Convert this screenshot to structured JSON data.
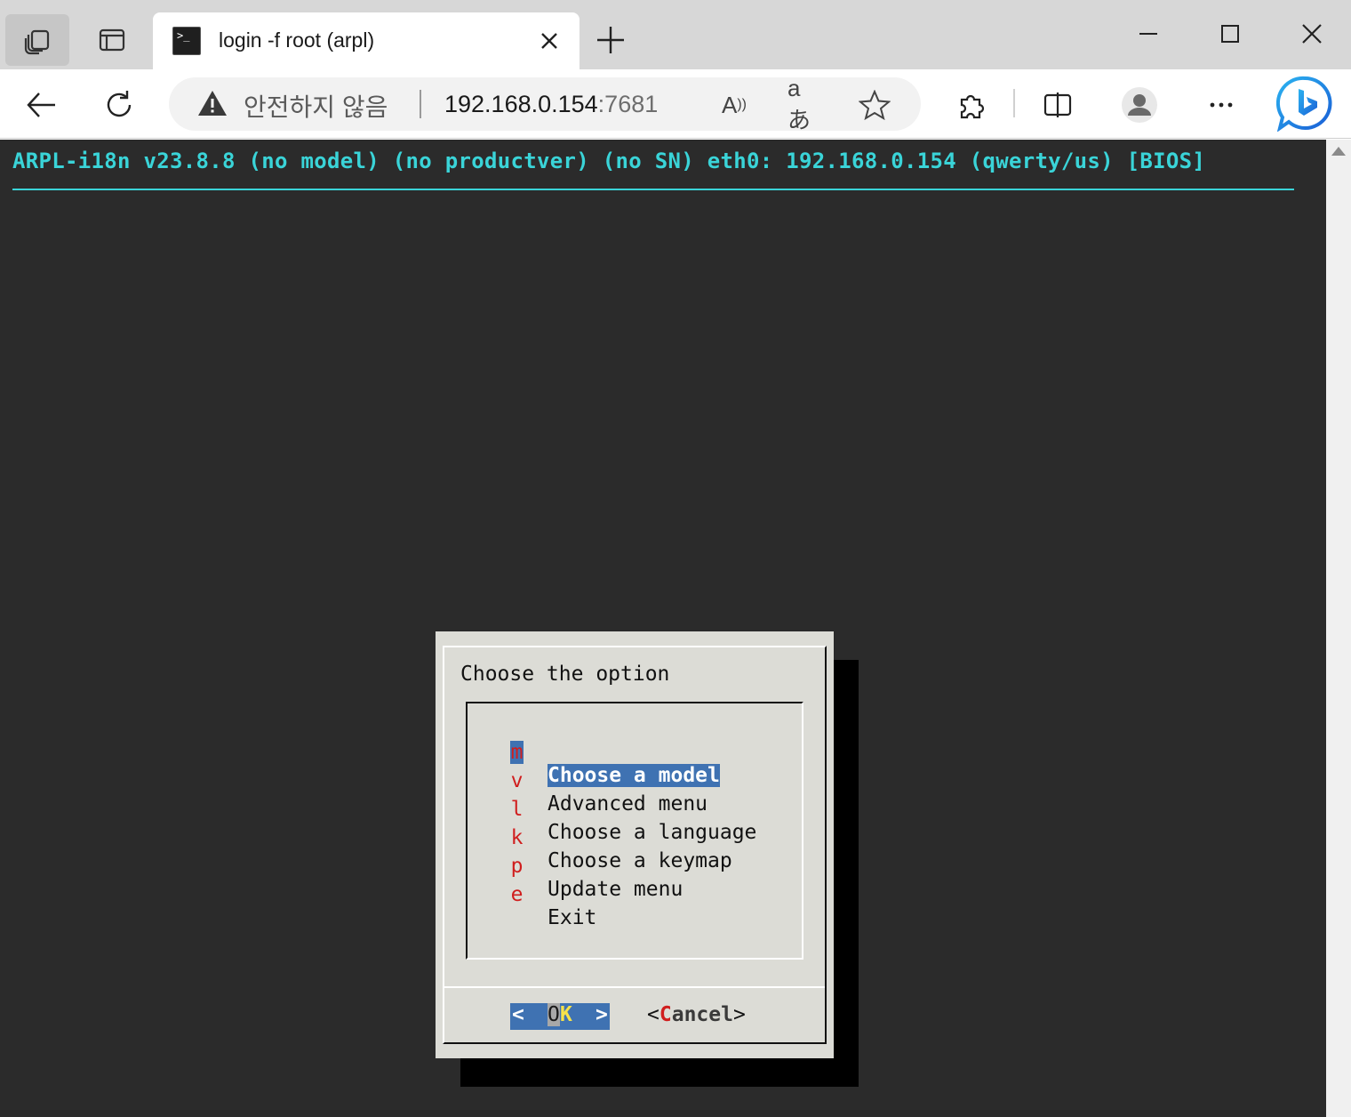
{
  "browser": {
    "tab": {
      "title": "login -f root (arpl)",
      "favicon_icon": "terminal-icon"
    },
    "address_bar": {
      "security_text": "안전하지 않음",
      "host": "192.168.0.154",
      "port": ":7681"
    },
    "toolbar_icons": [
      "back-icon",
      "refresh-icon",
      "read-aloud-icon",
      "translate-icon",
      "favorite-star-icon",
      "extensions-icon",
      "split-screen-icon",
      "profile-icon",
      "more-icon",
      "bing-icon"
    ]
  },
  "terminal": {
    "backtitle": "ARPL-i18n v23.8.8 (no model) (no productver) (no SN) eth0: 192.168.0.154 (qwerty/us) [BIOS]",
    "colors": {
      "background": "#2b2b2b",
      "accent": "#3ad4d8",
      "dialog_bg": "#dcdcd6",
      "highlight": "#3f72b2",
      "hotkey": "#d01e1e"
    },
    "dialog": {
      "prompt": "Choose the option",
      "selected_index": 0,
      "items": [
        {
          "key": "m",
          "label": "Choose a model"
        },
        {
          "key": "v",
          "label": "Advanced menu"
        },
        {
          "key": "l",
          "label": "Choose a language"
        },
        {
          "key": "k",
          "label": "Choose a keymap"
        },
        {
          "key": "p",
          "label": "Update menu"
        },
        {
          "key": "e",
          "label": "Exit"
        }
      ],
      "buttons": {
        "ok": {
          "left": "<",
          "o": "O",
          "k": "K",
          "right": ">"
        },
        "cancel": {
          "open": "<",
          "hotkey": "C",
          "rest": "ancel",
          "close": ">"
        }
      }
    }
  }
}
